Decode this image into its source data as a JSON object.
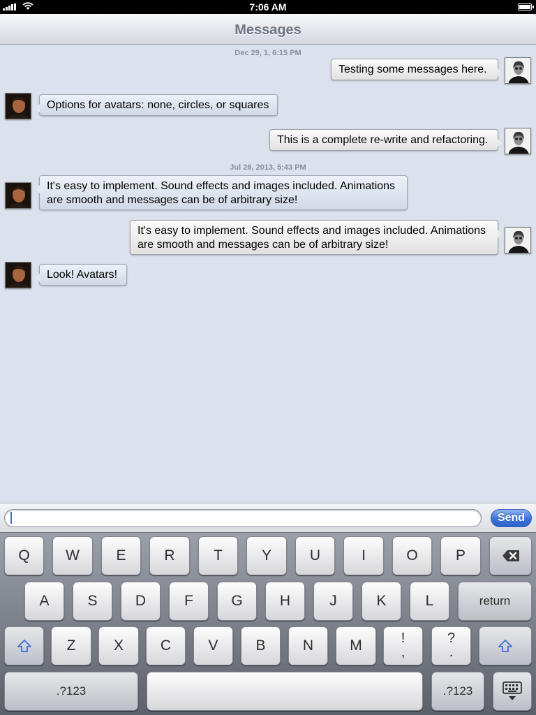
{
  "status_bar": {
    "time": "7:06 AM"
  },
  "nav": {
    "title": "Messages"
  },
  "messages": {
    "timestamp_1": "Dec 29, 1, 6:15 PM",
    "timestamp_2": "Jul 26, 2013, 5:43 PM",
    "items": [
      {
        "direction": "outgoing",
        "text": "Testing some messages here."
      },
      {
        "direction": "incoming",
        "text": "Options for avatars: none, circles, or squares"
      },
      {
        "direction": "outgoing",
        "text": "This is a complete re-write and refactoring."
      },
      {
        "direction": "incoming",
        "text": "It's easy to implement. Sound effects and images included. Animations are smooth and messages can be of arbitrary size!"
      },
      {
        "direction": "outgoing",
        "text": "It's easy to implement. Sound effects and images included. Animations are smooth and messages can be of arbitrary size!"
      },
      {
        "direction": "incoming",
        "text": "Look! Avatars!"
      }
    ]
  },
  "input": {
    "value": "",
    "send_label": "Send"
  },
  "keyboard": {
    "row1": [
      "Q",
      "W",
      "E",
      "R",
      "T",
      "Y",
      "U",
      "I",
      "O",
      "P"
    ],
    "row2": [
      "A",
      "S",
      "D",
      "F",
      "G",
      "H",
      "J",
      "K",
      "L"
    ],
    "row3": [
      "Z",
      "X",
      "C",
      "V",
      "B",
      "N",
      "M"
    ],
    "punct_1": {
      "top": "!",
      "bottom": ","
    },
    "punct_2": {
      "top": "?",
      "bottom": "."
    },
    "return_label": "return",
    "numbers_label": ".?123",
    "icons": [
      "backspace-icon",
      "shift-icon",
      "hide-keyboard-icon"
    ]
  },
  "colors": {
    "send_button": "#3a72d8",
    "chat_background": "#dbe2ed"
  }
}
